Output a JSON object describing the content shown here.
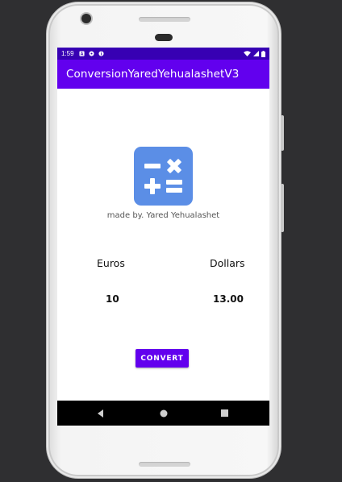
{
  "status_bar": {
    "time": "1:59",
    "icons": [
      "a-notification-icon",
      "chat-notification-icon",
      "info-notification-icon",
      "wifi-icon",
      "signal-icon",
      "battery-icon"
    ]
  },
  "app_bar": {
    "title": "ConversionYaredYehualashetV3"
  },
  "logo": {
    "icon": "calculator-icon",
    "color": "#5b8ee6"
  },
  "credit": {
    "text": "made by. Yared Yehualashet"
  },
  "currencies": {
    "from_label": "Euros",
    "to_label": "Dollars",
    "from_value": "10",
    "to_value": "13.00"
  },
  "actions": {
    "convert_label": "CONVERT"
  },
  "nav_bar": {
    "buttons": [
      "back-icon",
      "home-icon",
      "recents-icon"
    ]
  },
  "colors": {
    "primary": "#6200ee",
    "primary_dark": "#3700b3",
    "logo_blue": "#5b8ee6"
  }
}
